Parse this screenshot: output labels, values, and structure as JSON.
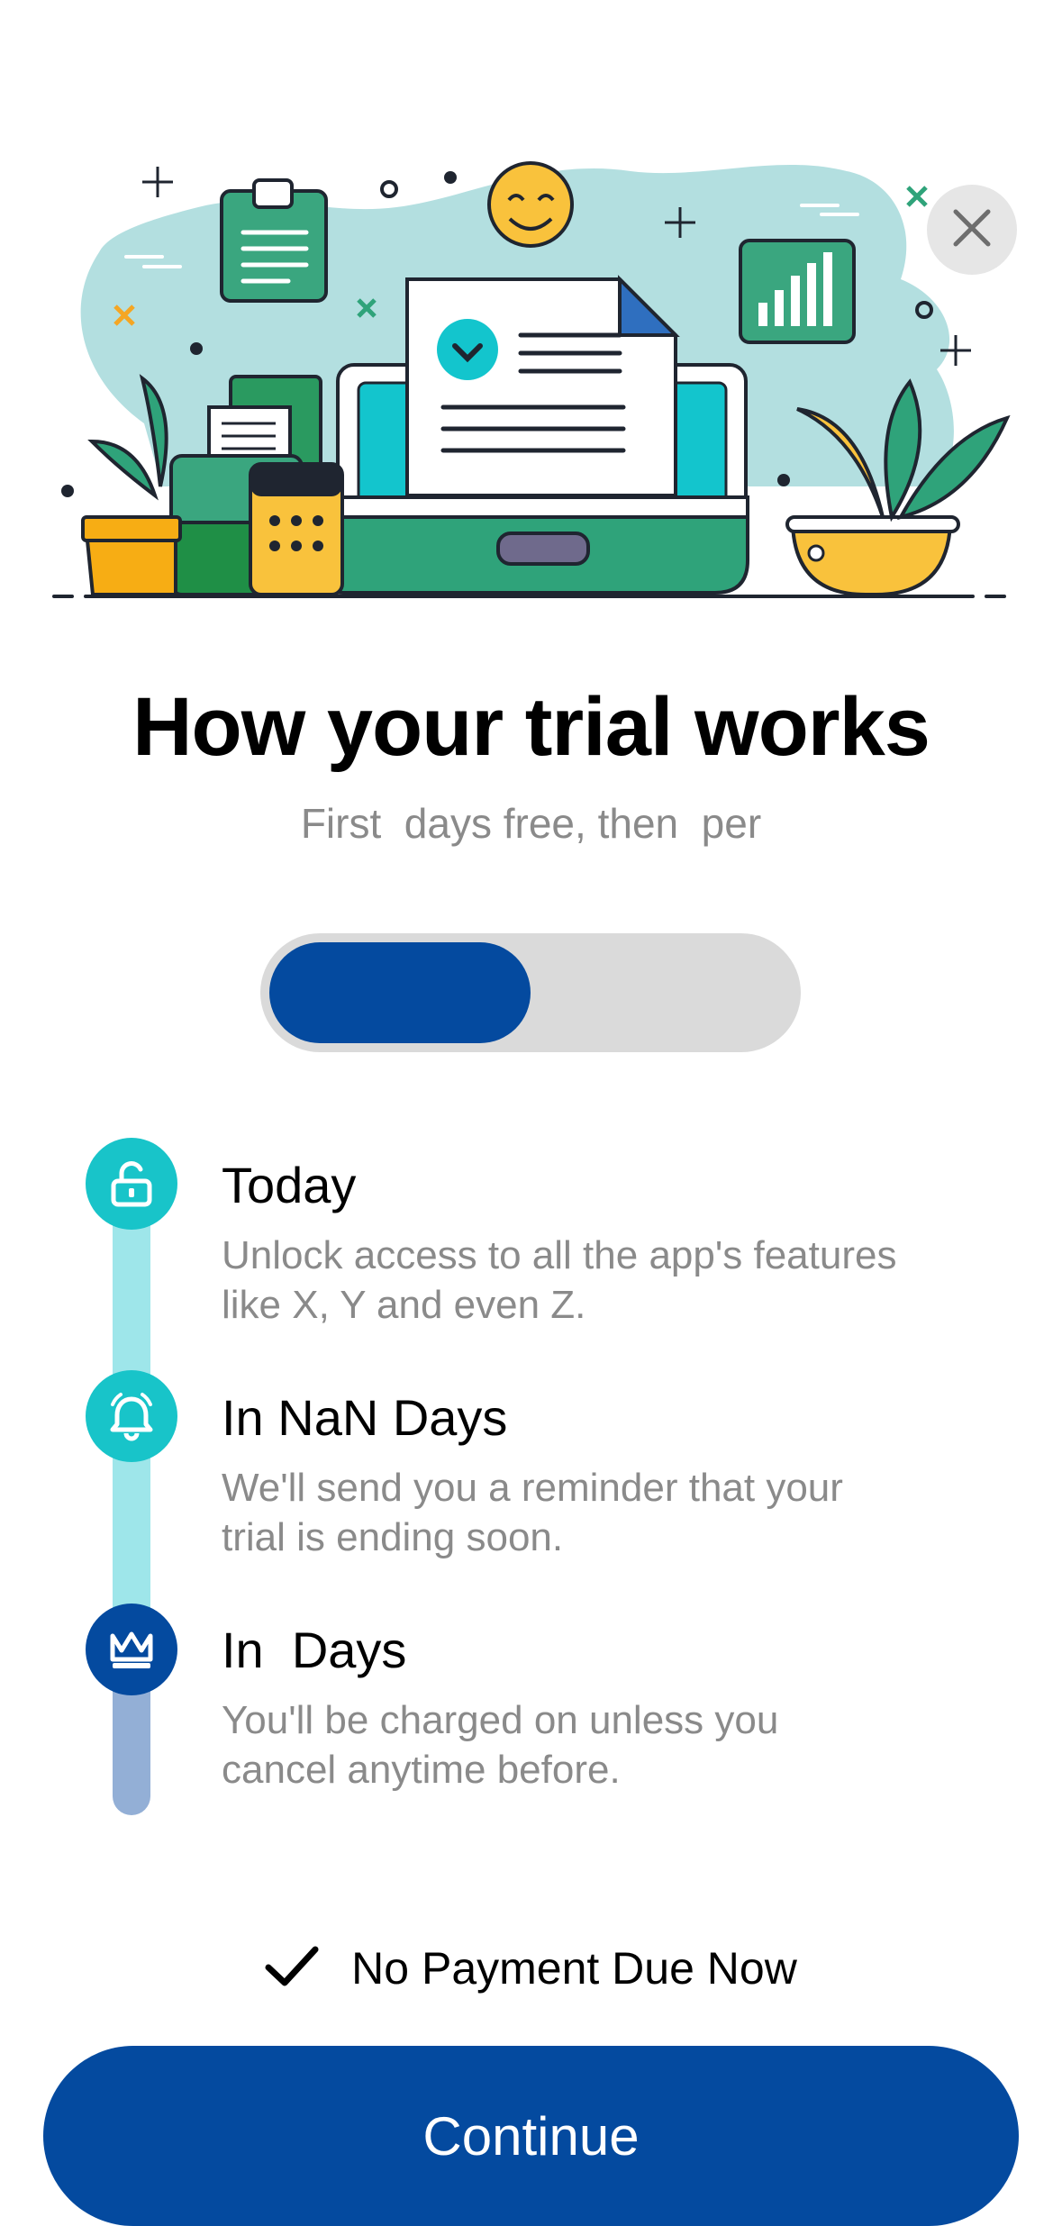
{
  "header": {
    "close_icon": "close-icon"
  },
  "hero": {
    "illustration": "trial-illustration",
    "elements": [
      "clipboard",
      "smiley-face",
      "document-with-check",
      "laptop",
      "bar-chart-card",
      "plant-pot-left",
      "plant-pot-right",
      "folders",
      "calculator"
    ]
  },
  "title": "How your trial works",
  "subtitle": "First  days free, then  per",
  "plan_toggle": {
    "selected_fill": 0.5,
    "active_color": "#044A9F",
    "track_color": "#DADADA"
  },
  "timeline": {
    "steps": [
      {
        "icon": "unlock-icon",
        "title": "Today",
        "description": "Unlock access to all the app's features\nlike X, Y and even Z.",
        "icon_color": "#18C4C9"
      },
      {
        "icon": "bell-icon",
        "title": "In NaN Days",
        "description": "We'll send you a reminder that your\ntrial is ending soon.",
        "icon_color": "#18C4C9"
      },
      {
        "icon": "crown-icon",
        "title": "In  Days",
        "description": "You'll be charged on  unless you\ncancel anytime before.",
        "icon_color": "#044A9F"
      }
    ]
  },
  "no_payment": {
    "icon": "checkmark-icon",
    "label": "No Payment Due Now"
  },
  "cta": {
    "label": "Continue",
    "color": "#044A9F"
  }
}
